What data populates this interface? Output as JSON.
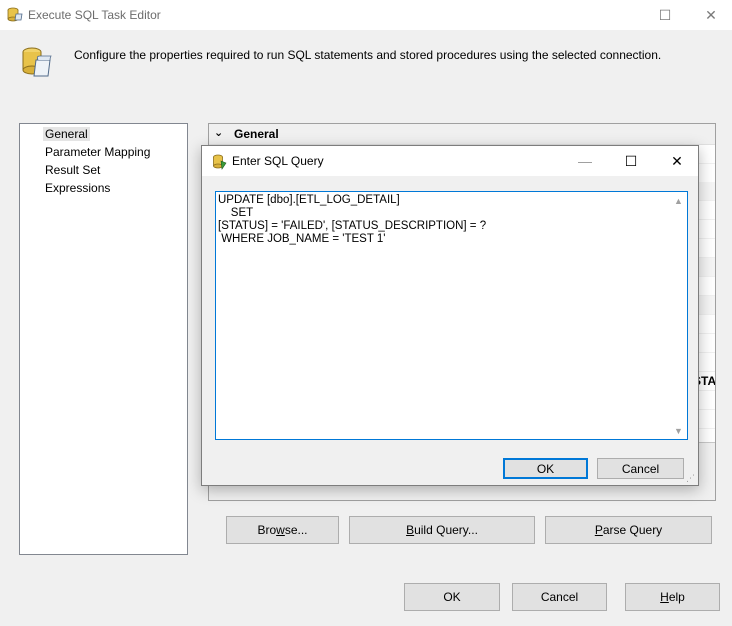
{
  "window": {
    "title": "Execute SQL Task Editor",
    "maximize_glyph": "☐",
    "close_glyph": "✕"
  },
  "header": {
    "description": "Configure the properties required to run SQL statements and stored procedures using the selected connection."
  },
  "nav": {
    "items": [
      {
        "label": "General",
        "selected": true
      },
      {
        "label": "Parameter Mapping",
        "selected": false
      },
      {
        "label": "Result Set",
        "selected": false
      },
      {
        "label": "Expressions",
        "selected": false
      }
    ]
  },
  "properties": {
    "section_label": "General",
    "chevron": "⌄",
    "clipped_text": "STATUS"
  },
  "buttons": {
    "browse": {
      "pre": "Bro",
      "ul": "w",
      "post": "se..."
    },
    "build_query": {
      "pre": "",
      "ul": "B",
      "post": "uild Query..."
    },
    "parse_query": {
      "pre": "",
      "ul": "P",
      "post": "arse Query"
    },
    "ok": "OK",
    "cancel": "Cancel",
    "help": {
      "pre": "",
      "ul": "H",
      "post": "elp"
    }
  },
  "dialog": {
    "title": "Enter SQL Query",
    "minimize_glyph": "—",
    "maximize_glyph": "☐",
    "close_glyph": "✕",
    "sql_text": "UPDATE [dbo].[ETL_LOG_DETAIL]\n    SET\n[STATUS] = 'FAILED', [STATUS_DESCRIPTION] = ?\n WHERE JOB_NAME = 'TEST 1'",
    "ok_label": "OK",
    "cancel_label": "Cancel",
    "scroll_up": "▲",
    "scroll_down": "▼",
    "grip": "⋰"
  }
}
